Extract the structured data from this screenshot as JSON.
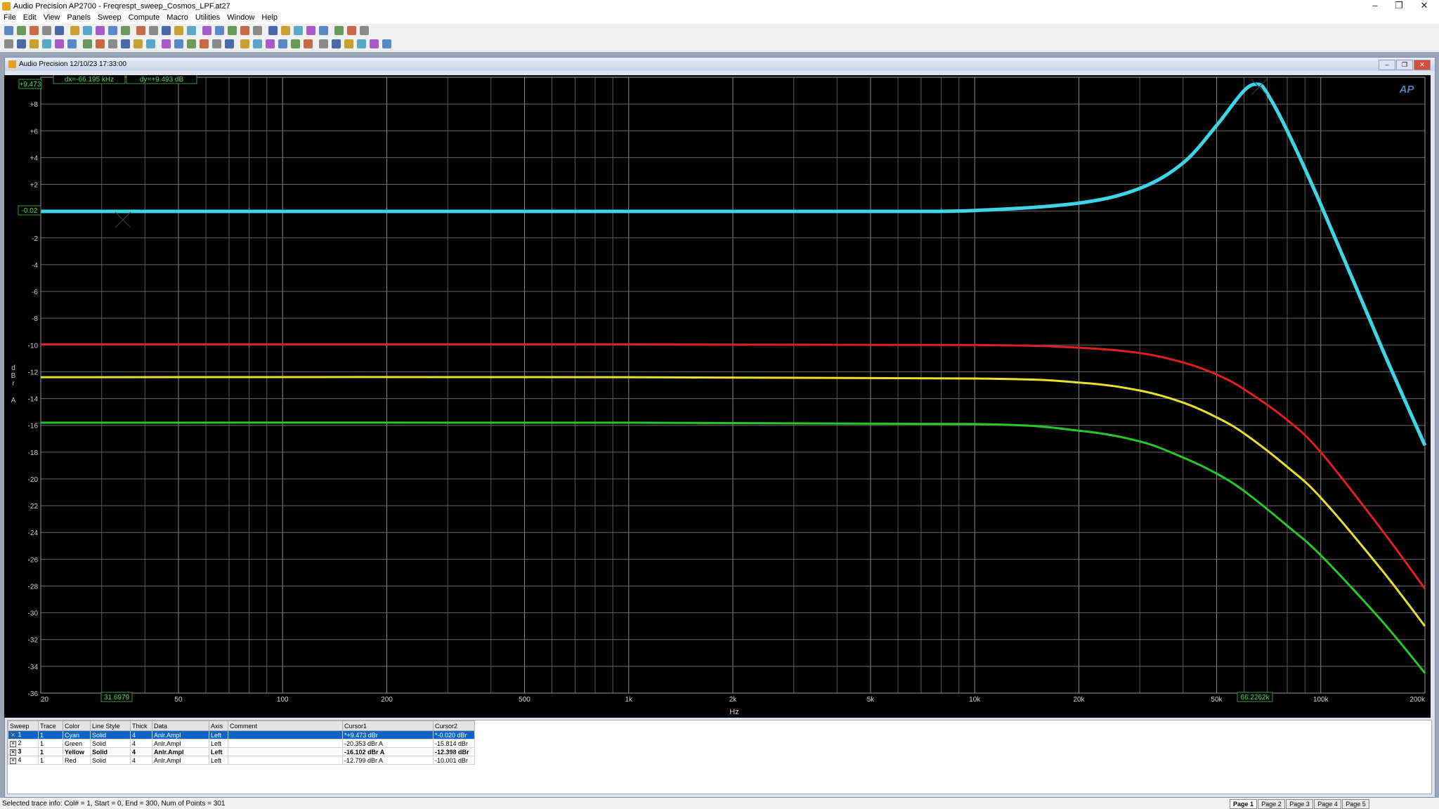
{
  "window": {
    "title": "Audio Precision AP2700 - Freqrespt_sweep_Cosmos_LPF.at27"
  },
  "menu": [
    "File",
    "Edit",
    "View",
    "Panels",
    "Sweep",
    "Compute",
    "Macro",
    "Utilities",
    "Window",
    "Help"
  ],
  "graph_window": {
    "title": "Audio Precision  12/10/23 17:33:00"
  },
  "readouts": {
    "cursor_y": "+9.473",
    "dx": "dx=-66.195 kHz",
    "dy": "dy=+9.493  dB",
    "cursor2_y": "-0.02",
    "cursor2_x": "31.6979",
    "cursor1_x": "66.2262k"
  },
  "logo": "AP",
  "chart_data": {
    "type": "line",
    "title": "",
    "xlabel": "Hz",
    "ylabel": "d B r   A",
    "xscale": "log",
    "xlim": [
      20,
      200000
    ],
    "ylim": [
      -36,
      10
    ],
    "x_ticks": [
      20,
      50,
      100,
      200,
      500,
      1000,
      2000,
      5000,
      10000,
      20000,
      50000,
      100000,
      200000
    ],
    "x_tick_labels": [
      "20",
      "50",
      "100",
      "200",
      "500",
      "1k",
      "2k",
      "5k",
      "10k",
      "20k",
      "50k",
      "100k",
      "200k"
    ],
    "y_ticks": [
      8,
      6,
      4,
      2,
      -2,
      -4,
      -6,
      -8,
      -10,
      -12,
      -14,
      -16,
      -18,
      -20,
      -22,
      -24,
      -26,
      -28,
      -30,
      -32,
      -34,
      -36
    ],
    "y_tick_labels": [
      "+8",
      "+6",
      "+4",
      "+2",
      "-2",
      "-4",
      "-6",
      "-8",
      "-10",
      "-12",
      "-14",
      "-16",
      "-18",
      "-20",
      "-22",
      "-24",
      "-26",
      "-28",
      "-30",
      "-32",
      "-34",
      "-36"
    ],
    "grid": true,
    "background": "#000000",
    "series": [
      {
        "color": "#3dd6e8",
        "x": [
          20,
          100,
          1000,
          5000,
          10000,
          20000,
          30000,
          40000,
          50000,
          60000,
          66000,
          70000,
          80000,
          100000,
          150000,
          200000
        ],
        "y": [
          -0.02,
          -0.02,
          -0.02,
          -0.02,
          0.05,
          0.6,
          1.7,
          3.6,
          6.4,
          9.0,
          9.47,
          8.8,
          6.0,
          0.5,
          -10.2,
          -17.5
        ]
      },
      {
        "color": "#e02020",
        "x": [
          20,
          1000,
          10000,
          20000,
          30000,
          40000,
          50000,
          60000,
          80000,
          100000,
          150000,
          200000
        ],
        "y": [
          -9.96,
          -9.96,
          -10.0,
          -10.2,
          -10.6,
          -11.3,
          -12.2,
          -13.3,
          -15.6,
          -18.0,
          -23.8,
          -28.2
        ]
      },
      {
        "color": "#e8e030",
        "x": [
          20,
          1000,
          10000,
          20000,
          30000,
          40000,
          50000,
          60000,
          80000,
          100000,
          150000,
          200000
        ],
        "y": [
          -12.4,
          -12.4,
          -12.5,
          -12.8,
          -13.4,
          -14.3,
          -15.4,
          -16.6,
          -19.1,
          -21.4,
          -26.8,
          -31.0
        ]
      },
      {
        "color": "#28c828",
        "x": [
          20,
          1000,
          10000,
          20000,
          30000,
          40000,
          50000,
          60000,
          80000,
          100000,
          150000,
          200000
        ],
        "y": [
          -15.8,
          -15.8,
          -15.9,
          -16.4,
          -17.2,
          -18.4,
          -19.6,
          -20.9,
          -23.5,
          -25.7,
          -30.6,
          -34.5
        ]
      }
    ]
  },
  "trace_table": {
    "headers": [
      "Sweep",
      "Trace",
      "Color",
      "Line Style",
      "Thick",
      "Data",
      "Axis",
      "Comment",
      "Cursor1",
      "Cursor2"
    ],
    "rows": [
      {
        "sweep": "1",
        "trace": "1",
        "color": "Cyan",
        "style": "Solid",
        "thick": "4",
        "data": "Anlr.Ampl",
        "axis": "Left",
        "comment": "",
        "c1": "*+9.473  dBr",
        "c2": "*-0.020  dBr"
      },
      {
        "sweep": "2",
        "trace": "1",
        "color": "Green",
        "style": "Solid",
        "thick": "4",
        "data": "Anlr.Ampl",
        "axis": "Left",
        "comment": "",
        "c1": "-20.353  dBr A",
        "c2": "-15.814  dBr"
      },
      {
        "sweep": "3",
        "trace": "1",
        "color": "Yellow",
        "style": "Solid",
        "thick": "4",
        "data": "Anlr.Ampl",
        "axis": "Left",
        "comment": "",
        "c1": "-16.102  dBr A",
        "c2": "-12.398  dBr"
      },
      {
        "sweep": "4",
        "trace": "1",
        "color": "Red",
        "style": "Solid",
        "thick": "4",
        "data": "Anlr.Ampl",
        "axis": "Left",
        "comment": "",
        "c1": "-12.799  dBr A",
        "c2": "-10.001  dBr"
      }
    ]
  },
  "status": {
    "text": "Selected trace info: Col# = 1, Start = 0, End = 300, Num of Points = 301"
  },
  "page_tabs": [
    "Page 1",
    "Page 2",
    "Page 3",
    "Page 4",
    "Page 5"
  ]
}
